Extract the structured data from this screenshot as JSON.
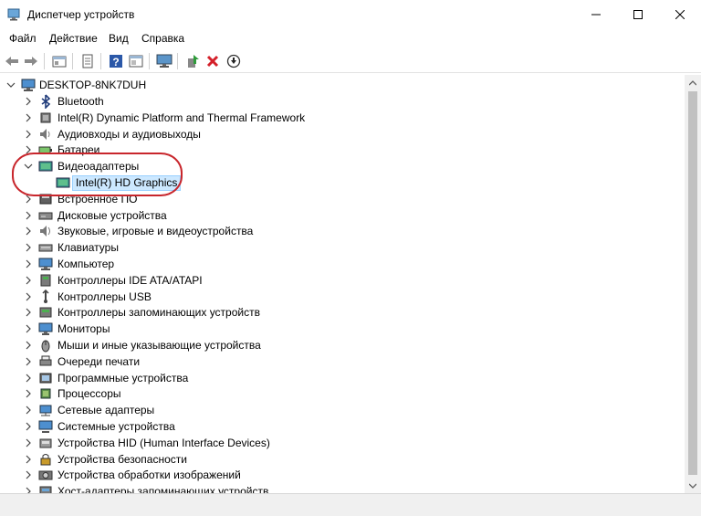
{
  "window": {
    "title": "Диспетчер устройств"
  },
  "menu": [
    "Файл",
    "Действие",
    "Вид",
    "Справка"
  ],
  "tree": {
    "root": "DESKTOP-8NK7DUH",
    "categories": [
      {
        "label": "Bluetooth",
        "icon": "bluetooth-icon"
      },
      {
        "label": "Intel(R) Dynamic Platform and Thermal Framework",
        "icon": "chip-icon"
      },
      {
        "label": "Аудиовходы и аудиовыходы",
        "icon": "speaker-icon"
      },
      {
        "label": "Батареи",
        "icon": "battery-icon"
      },
      {
        "label": "Видеоадаптеры",
        "icon": "display-adapter-icon",
        "expanded": true,
        "children": [
          {
            "label": "Intel(R) HD Graphics",
            "icon": "display-adapter-icon",
            "selected": true
          }
        ]
      },
      {
        "label": "Встроенное ПО",
        "icon": "firmware-icon"
      },
      {
        "label": "Дисковые устройства",
        "icon": "disk-icon"
      },
      {
        "label": "Звуковые, игровые и видеоустройства",
        "icon": "sound-icon"
      },
      {
        "label": "Клавиатуры",
        "icon": "keyboard-icon"
      },
      {
        "label": "Компьютер",
        "icon": "computer-icon"
      },
      {
        "label": "Контроллеры IDE ATA/ATAPI",
        "icon": "ide-controller-icon"
      },
      {
        "label": "Контроллеры USB",
        "icon": "usb-icon"
      },
      {
        "label": "Контроллеры запоминающих устройств",
        "icon": "storage-controller-icon"
      },
      {
        "label": "Мониторы",
        "icon": "monitor-icon"
      },
      {
        "label": "Мыши и иные указывающие устройства",
        "icon": "mouse-icon"
      },
      {
        "label": "Очереди печати",
        "icon": "printer-icon"
      },
      {
        "label": "Программные устройства",
        "icon": "software-device-icon"
      },
      {
        "label": "Процессоры",
        "icon": "processor-icon"
      },
      {
        "label": "Сетевые адаптеры",
        "icon": "network-adapter-icon"
      },
      {
        "label": "Системные устройства",
        "icon": "system-device-icon"
      },
      {
        "label": "Устройства HID (Human Interface Devices)",
        "icon": "hid-icon"
      },
      {
        "label": "Устройства безопасности",
        "icon": "security-device-icon"
      },
      {
        "label": "Устройства обработки изображений",
        "icon": "camera-icon"
      },
      {
        "label": "Хост-адаптеры запоминающих устройств",
        "icon": "storage-host-icon"
      }
    ]
  },
  "colors": {
    "highlight_oval": "#c8262c",
    "selection_bg": "#cce8ff",
    "selection_border": "#99d1ff"
  }
}
